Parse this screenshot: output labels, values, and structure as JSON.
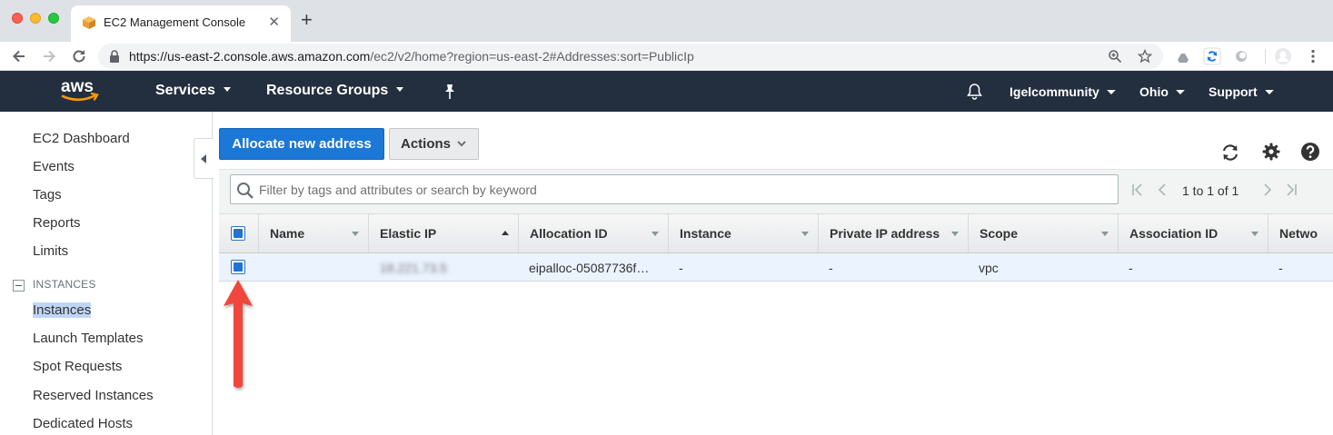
{
  "browser": {
    "tab_title": "EC2 Management Console",
    "url_host": "https://us-east-2.console.aws.amazon.com",
    "url_path": "/ec2/v2/home?region=us-east-2#Addresses:sort=PublicIp"
  },
  "aws_nav": {
    "services": "Services",
    "resource_groups": "Resource Groups",
    "account": "Igelcommunity",
    "region": "Ohio",
    "support": "Support"
  },
  "sidebar": {
    "items_top": [
      "EC2 Dashboard",
      "Events",
      "Tags",
      "Reports",
      "Limits"
    ],
    "section_label": "INSTANCES",
    "items_instances": [
      "Instances",
      "Launch Templates",
      "Spot Requests",
      "Reserved Instances",
      "Dedicated Hosts"
    ],
    "selected": "Instances"
  },
  "toolbar": {
    "allocate_label": "Allocate new address",
    "actions_label": "Actions"
  },
  "filter": {
    "placeholder": "Filter by tags and attributes or search by keyword"
  },
  "pager": {
    "text": "1 to 1 of 1"
  },
  "table": {
    "columns": [
      "Name",
      "Elastic IP",
      "Allocation ID",
      "Instance",
      "Private IP address",
      "Scope",
      "Association ID",
      "Netwo"
    ],
    "sorted_column": "Elastic IP",
    "rows": [
      {
        "name": "",
        "elastic_ip": "18.221.73.5",
        "allocation_id": "eipalloc-05087736f…",
        "instance": "-",
        "private_ip": "-",
        "scope": "vpc",
        "association_id": "-",
        "network": "-",
        "selected": true
      }
    ]
  },
  "colors": {
    "aws_nav_bg": "#232f3e",
    "primary_button": "#1b78d6",
    "selected_row": "#eaf3fe",
    "annotation_arrow": "#f0473d"
  }
}
